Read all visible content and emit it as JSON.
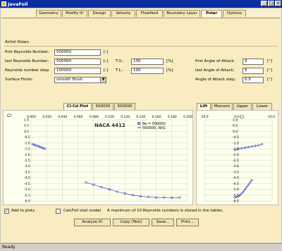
{
  "window": {
    "title": "JavaFoil",
    "min": "_",
    "max": "□",
    "close": "×"
  },
  "tabs": [
    {
      "label": "Geometry"
    },
    {
      "label": "Modify It!"
    },
    {
      "label": "Design"
    },
    {
      "label": "Velocity"
    },
    {
      "label": "Flowfield"
    },
    {
      "label": "Boundary Layer"
    },
    {
      "label": "Polar"
    },
    {
      "label": "Options"
    }
  ],
  "active_tab": "Polar",
  "section_title": "Airfoil Polars",
  "form": {
    "first_re_label": "first Reynolds Number:",
    "first_re_value": "500000",
    "first_re_unit": "[-]",
    "last_re_label": "last Reynolds Number:",
    "last_re_value": "500000",
    "last_re_unit": "[-]",
    "re_step_label": "Reynolds number step:",
    "re_step_value": "100000",
    "re_step_unit": "[-]",
    "tu_label": "T.U.:",
    "tu_value": "100",
    "tu_unit": "[%]",
    "tl_label": "T.L.:",
    "tl_value": "100",
    "tl_unit": "[%]",
    "first_aoa_label": "first Angle of Attack:",
    "first_aoa_value": "0",
    "first_aoa_unit": "[°]",
    "last_aoa_label": "last Angle of Attack:",
    "last_aoa_value": "5",
    "last_aoa_unit": "[°]",
    "aoa_step_label": "Angle of Attack step:",
    "aoa_step_value": "0.5",
    "aoa_step_unit": "[°]",
    "surface_label": "Surface Finish:",
    "surface_value": "smooth finish"
  },
  "left_subtabs": [
    {
      "label": "Cl-Cd Plot"
    },
    {
      "label": "500000"
    },
    {
      "label": "500000"
    }
  ],
  "right_subtabs": [
    {
      "label": "Lift"
    },
    {
      "label": "Moment"
    },
    {
      "label": "Upper"
    },
    {
      "label": "Lower"
    }
  ],
  "chart_data": [
    {
      "type": "scatter",
      "title": "NACA 4412",
      "ylabel_top": "Cl",
      "legend": [
        {
          "name": "Re = 500000",
          "color": "#2030c0"
        },
        {
          "name": "500000, W/G",
          "color": "#2030c0"
        }
      ],
      "x_ticks": [
        "0.000",
        "0.020",
        "0.040",
        "0.060",
        "0.080",
        "0.100",
        "0.120",
        "0.140",
        "0.160",
        "0.180",
        "0.200"
      ],
      "y_ticks": [
        "1.0",
        "0.5",
        "0.0",
        "-0.5",
        "-1.0",
        "-1.5",
        "-2.0",
        "-2.5",
        "-3.0",
        "-3.5",
        "-4.0",
        "-4.5",
        "-5.0",
        "-5.5",
        "-6.0"
      ],
      "xlim": [
        0,
        0.2
      ],
      "ylim": [
        -6.0,
        1.0
      ],
      "series": [
        {
          "x": [
            0.002,
            0.004,
            0.006,
            0.008,
            0.01,
            0.012,
            0.014,
            0.016,
            0.018
          ],
          "y": [
            -1.1,
            -1.15,
            -1.2,
            -1.25,
            -1.3,
            -1.35,
            -1.4,
            -1.45,
            -1.5
          ]
        },
        {
          "x": [
            0.07,
            0.08,
            0.09,
            0.1,
            0.11,
            0.12,
            0.13,
            0.14,
            0.15,
            0.16,
            0.17,
            0.18,
            0.19
          ],
          "y": [
            -4.4,
            -4.6,
            -4.8,
            -5.0,
            -5.2,
            -5.35,
            -5.5,
            -5.6,
            -5.65,
            -5.7,
            -5.7,
            -5.72,
            -5.7
          ]
        }
      ]
    },
    {
      "type": "scatter",
      "ylabel_top": "Cl",
      "x_ticks": [
        "-10.0",
        "0.0",
        "10.0"
      ],
      "y_ticks": [
        "1.0",
        "0.5",
        "0.0",
        "-0.5",
        "-1.0",
        "-1.5",
        "-2.0",
        "-2.5",
        "-3.0",
        "-3.5",
        "-4.0",
        "-4.5",
        "-5.0",
        "-5.5",
        "-6.0"
      ],
      "xlim": [
        -10,
        10
      ],
      "ylim": [
        -6.0,
        1.0
      ],
      "series": [
        {
          "x": [
            -1,
            0,
            1,
            2,
            3,
            4,
            5,
            6,
            7
          ],
          "y": [
            -1.6,
            -1.5,
            -1.45,
            -1.4,
            -1.35,
            -1.3,
            -1.25,
            -1.2,
            -1.1
          ]
        },
        {
          "x": [
            -1,
            -0.5,
            0,
            0.5,
            1,
            1.5,
            2,
            2.5,
            3,
            3.5,
            4
          ],
          "y": [
            -5.7,
            -5.65,
            -5.6,
            -5.5,
            -5.35,
            -5.2,
            -5.0,
            -4.8,
            -4.6,
            -4.4,
            -4.2
          ]
        }
      ]
    }
  ],
  "bottom": {
    "add_to_plots_label": "Add to plots",
    "add_to_plots_checked": true,
    "calcfoil_label": "CalcFoil stall model",
    "calcfoil_checked": false,
    "info_text": "A maximum of 10 Reynolds numbers is stored in the tables.",
    "analyze_label": "Analyze It!",
    "copy_label": "Copy (Text)",
    "save_label": "Save...",
    "print_label": "Print..."
  },
  "status": "Ready"
}
